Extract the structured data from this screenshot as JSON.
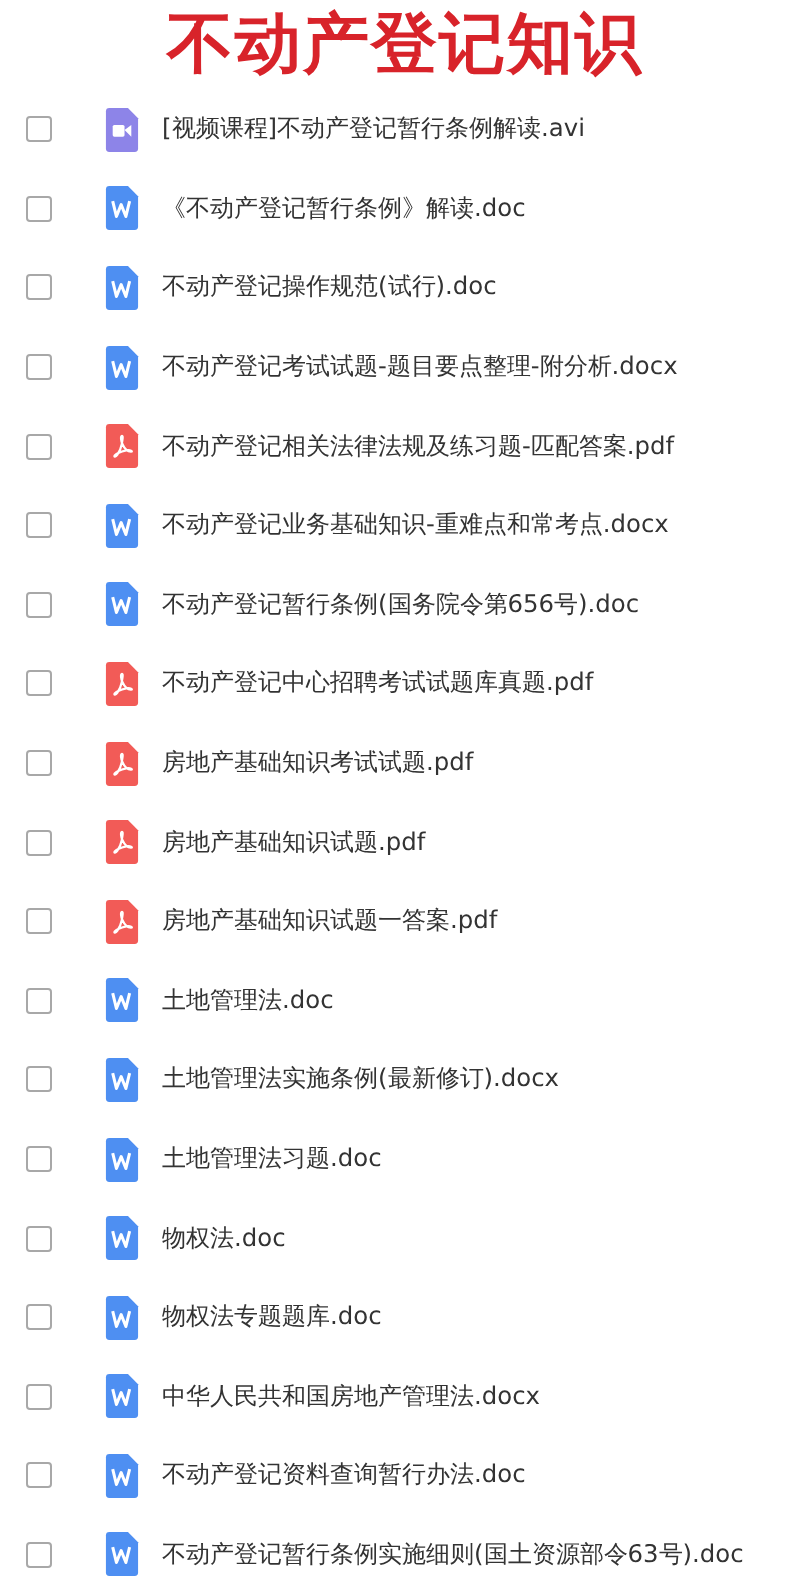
{
  "title": "不动产登记知识",
  "files": [
    {
      "kind": "video",
      "name": "[视频课程]不动产登记暂行条例解读.avi",
      "checked": false
    },
    {
      "kind": "word",
      "name": "《不动产登记暂行条例》解读.doc",
      "checked": false
    },
    {
      "kind": "word",
      "name": "不动产登记操作规范(试行).doc",
      "checked": false
    },
    {
      "kind": "word",
      "name": "不动产登记考试试题-题目要点整理-附分析.docx",
      "checked": false
    },
    {
      "kind": "pdf",
      "name": "不动产登记相关法律法规及练习题-匹配答案.pdf",
      "checked": false
    },
    {
      "kind": "word",
      "name": "不动产登记业务基础知识-重难点和常考点.docx",
      "checked": false
    },
    {
      "kind": "word",
      "name": "不动产登记暂行条例(国务院令第656号).doc",
      "checked": false
    },
    {
      "kind": "pdf",
      "name": "不动产登记中心招聘考试试题库真题.pdf",
      "checked": false
    },
    {
      "kind": "pdf",
      "name": "房地产基础知识考试试题.pdf",
      "checked": false
    },
    {
      "kind": "pdf",
      "name": "房地产基础知识试题.pdf",
      "checked": false
    },
    {
      "kind": "pdf",
      "name": "房地产基础知识试题一答案.pdf",
      "checked": false
    },
    {
      "kind": "word",
      "name": "土地管理法.doc",
      "checked": false
    },
    {
      "kind": "word",
      "name": "土地管理法实施条例(最新修订).docx",
      "checked": false
    },
    {
      "kind": "word",
      "name": "土地管理法习题.doc",
      "checked": false
    },
    {
      "kind": "word",
      "name": "物权法.doc",
      "checked": false
    },
    {
      "kind": "word",
      "name": "物权法专题题库.doc",
      "checked": false
    },
    {
      "kind": "word",
      "name": "中华人民共和国房地产管理法.docx",
      "checked": false
    },
    {
      "kind": "word",
      "name": "不动产登记资料查询暂行办法.doc",
      "checked": false
    },
    {
      "kind": "word",
      "name": "不动产登记暂行条例实施细则(国土资源部令63号).doc",
      "checked": false
    }
  ]
}
